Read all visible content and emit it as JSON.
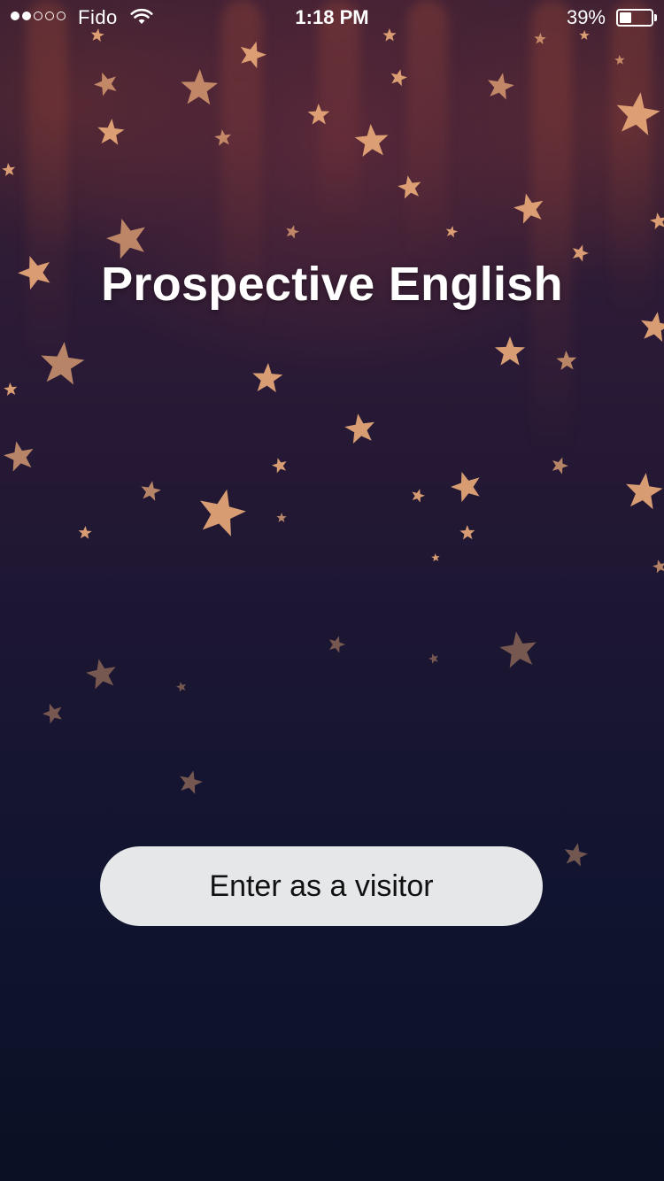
{
  "status_bar": {
    "signal_strength": 2,
    "signal_max": 5,
    "carrier": "Fido",
    "wifi_icon": "wifi-icon",
    "time": "1:18 PM",
    "battery_percent": "39%",
    "battery_level": 0.39
  },
  "main": {
    "title": "Prospective English",
    "background": "starry-night-background",
    "visitor_button_label": "Enter as a visitor"
  },
  "colors": {
    "title_text": "#ffffff",
    "button_background": "#e6e7e9",
    "button_text": "#111111",
    "star": "#e8a878"
  }
}
